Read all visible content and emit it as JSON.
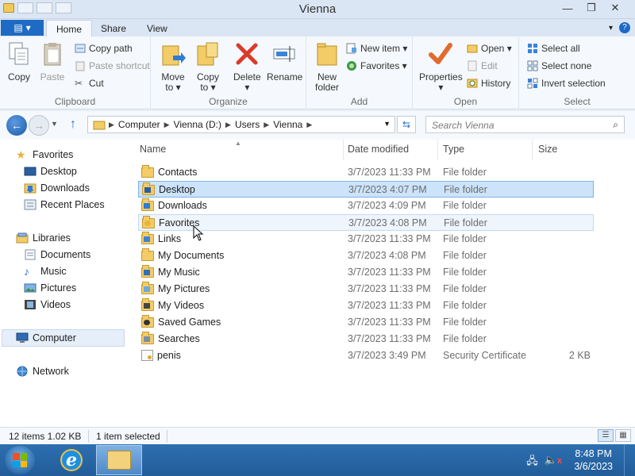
{
  "window": {
    "title": "Vienna",
    "minimize": "—",
    "maximize": "❐",
    "close": "✕"
  },
  "ribbon_tabs": [
    {
      "label": "Home"
    },
    {
      "label": "Share"
    },
    {
      "label": "View"
    }
  ],
  "ribbon": {
    "clipboard": {
      "label": "Clipboard",
      "copy": "Copy",
      "paste": "Paste",
      "copy_path": "Copy path",
      "paste_shortcut": "Paste shortcut",
      "cut": "Cut"
    },
    "organize": {
      "label": "Organize",
      "move_to_1": "Move",
      "move_to_2": "to ▾",
      "copy_to_1": "Copy",
      "copy_to_2": "to ▾",
      "delete_1": "Delete",
      "delete_2": "▾",
      "rename": "Rename"
    },
    "new": {
      "label": "Add",
      "new_folder_1": "New",
      "new_folder_2": "folder",
      "new_item": "New item ▾",
      "favorites": "Favorites ▾"
    },
    "open": {
      "label": "Open",
      "properties_1": "Properties",
      "properties_2": "▾",
      "open": "Open ▾",
      "edit": "Edit",
      "history": "History"
    },
    "select": {
      "label": "Select",
      "select_all": "Select all",
      "select_none": "Select none",
      "invert": "Invert selection"
    }
  },
  "address": {
    "crumbs": [
      "Computer",
      "Vienna (D:)",
      "Users",
      "Vienna"
    ],
    "search_placeholder": "Search Vienna"
  },
  "nav": {
    "favorites": "Favorites",
    "desktop": "Desktop",
    "downloads": "Downloads",
    "recent": "Recent Places",
    "libraries": "Libraries",
    "documents": "Documents",
    "music": "Music",
    "pictures": "Pictures",
    "videos": "Videos",
    "computer": "Computer",
    "network": "Network"
  },
  "columns": {
    "name": "Name",
    "date": "Date modified",
    "type": "Type",
    "size": "Size"
  },
  "files": [
    {
      "name": "Contacts",
      "date": "3/7/2023 11:33 PM",
      "type": "File folder",
      "size": ""
    },
    {
      "name": "Desktop",
      "date": "3/7/2023 4:07 PM",
      "type": "File folder",
      "size": ""
    },
    {
      "name": "Downloads",
      "date": "3/7/2023 4:09 PM",
      "type": "File folder",
      "size": ""
    },
    {
      "name": "Favorites",
      "date": "3/7/2023 4:08 PM",
      "type": "File folder",
      "size": ""
    },
    {
      "name": "Links",
      "date": "3/7/2023 11:33 PM",
      "type": "File folder",
      "size": ""
    },
    {
      "name": "My Documents",
      "date": "3/7/2023 4:08 PM",
      "type": "File folder",
      "size": ""
    },
    {
      "name": "My Music",
      "date": "3/7/2023 11:33 PM",
      "type": "File folder",
      "size": ""
    },
    {
      "name": "My Pictures",
      "date": "3/7/2023 11:33 PM",
      "type": "File folder",
      "size": ""
    },
    {
      "name": "My Videos",
      "date": "3/7/2023 11:33 PM",
      "type": "File folder",
      "size": ""
    },
    {
      "name": "Saved Games",
      "date": "3/7/2023 11:33 PM",
      "type": "File folder",
      "size": ""
    },
    {
      "name": "Searches",
      "date": "3/7/2023 11:33 PM",
      "type": "File folder",
      "size": ""
    },
    {
      "name": "penis",
      "date": "3/7/2023 3:49 PM",
      "type": "Security Certificate",
      "size": "2 KB"
    }
  ],
  "status": {
    "count": "12 items  1.02 KB",
    "selected": "1 item selected"
  },
  "taskbar": {
    "time": "8:48 PM",
    "date": "3/6/2023"
  }
}
